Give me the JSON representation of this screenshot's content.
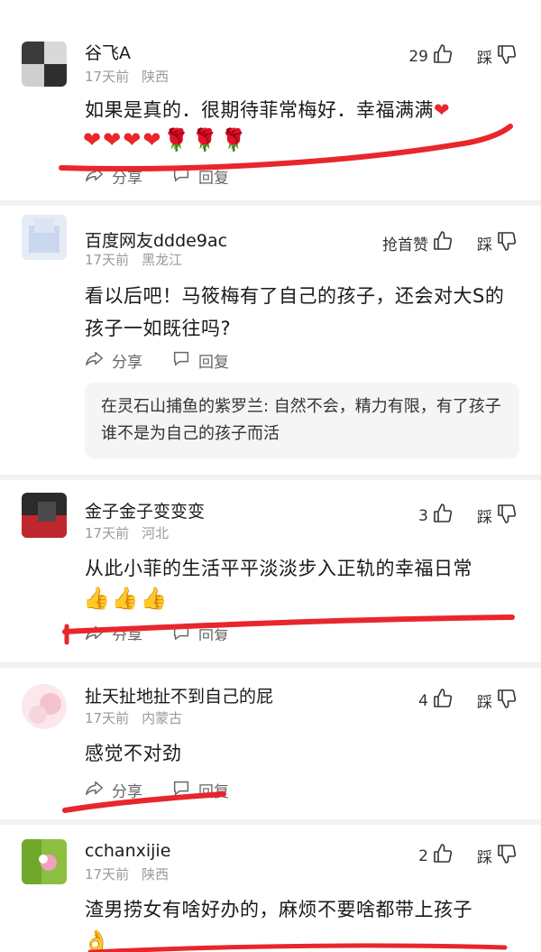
{
  "comments": [
    {
      "username": "谷飞A",
      "time": "17天前",
      "location": "陕西",
      "likes": "29",
      "dislike_label": "踩",
      "text": "如果是真的．很期待菲常梅好．幸福满满",
      "emojis": [
        "❤",
        "❤",
        "❤",
        "❤",
        "❤",
        "🌹",
        "🌹",
        "🌹"
      ],
      "share_label": "分享",
      "reply_label": "回复"
    },
    {
      "username": "百度网友ddde9ac",
      "time": "17天前",
      "location": "黑龙江",
      "likes": "抢首赞",
      "dislike_label": "踩",
      "text": "看以后吧！马筱梅有了自己的孩子，还会对大S的孩子一如既往吗?",
      "share_label": "分享",
      "reply_label": "回复",
      "reply": {
        "name": "在灵石山捕鱼的紫罗兰",
        "text": ": 自然不会，精力有限，有了孩子谁不是为自己的孩子而活"
      }
    },
    {
      "username": "金子金子变变变",
      "time": "17天前",
      "location": "河北",
      "likes": "3",
      "dislike_label": "踩",
      "text": "从此小菲的生活平平淡淡步入正轨的幸福日常",
      "emojis": [
        "👍",
        "👍",
        "👍"
      ],
      "share_label": "分享",
      "reply_label": "回复"
    },
    {
      "username": "扯天扯地扯不到自己的屁",
      "time": "17天前",
      "location": "内蒙古",
      "likes": "4",
      "dislike_label": "踩",
      "text": "感觉不对劲",
      "share_label": "分享",
      "reply_label": "回复"
    },
    {
      "username": "cchanxijie",
      "time": "17天前",
      "location": "陕西",
      "likes": "2",
      "dislike_label": "踩",
      "text": "渣男捞女有啥好办的，麻烦不要啥都带上孩子",
      "emojis": [
        "👌"
      ]
    }
  ],
  "colors": {
    "scribble": "#e8262b",
    "meta_text": "#9a9a9a",
    "reply_bg": "#f5f5f5"
  }
}
